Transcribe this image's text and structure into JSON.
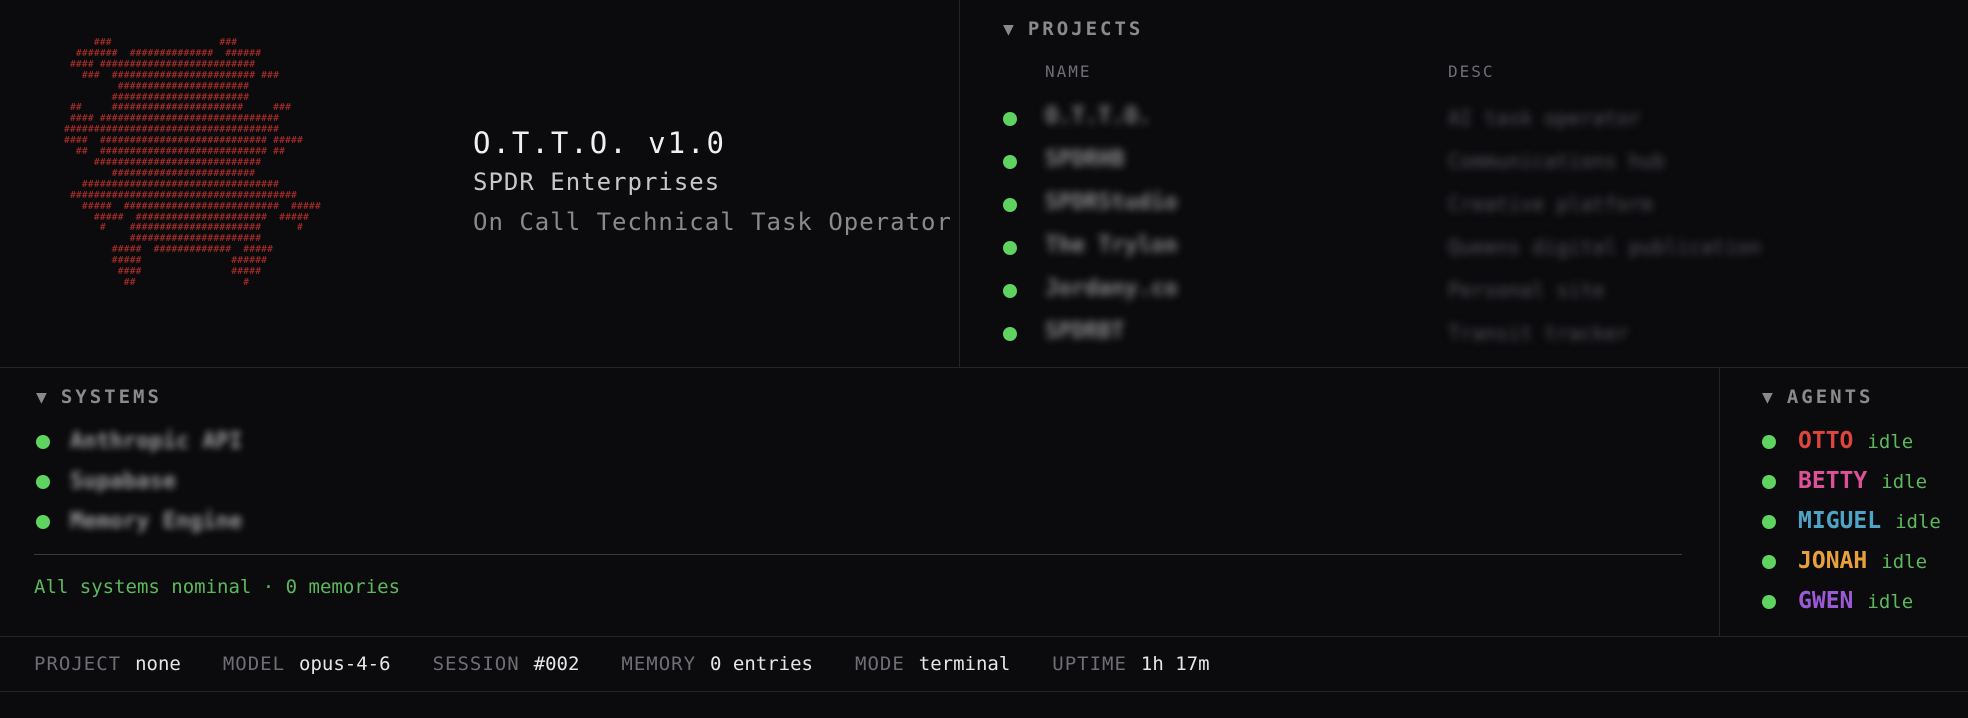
{
  "logo": {
    "ascii_art": "      ###                  ###\n   #######  ##############  ######\n  #### ##########################\n    ###  ######################## ###\n          ######################\n         #######################\n  ##     ######################     ###\n  #### ##############################\n ####################################\n ####  ############################ #####\n   ##  ############################ ##\n      ############################\n         ########################\n    #################################\n  ######################################\n    #####  ##########################  #####\n      #####  ######################  #####\n       #    ######################      #\n            ######################\n         #####  #############  #####\n         #####               ######\n          ####               #####\n           ##                  #"
  },
  "brand": {
    "title": "O.T.T.O. v1.0",
    "company": "SPDR Enterprises",
    "description": "On Call Technical Task Operator"
  },
  "projects": {
    "title": "PROJECTS",
    "col_name": "NAME",
    "col_desc": "DESC",
    "rows": [
      {
        "name": "O.T.T.O.",
        "desc": "AI task operator"
      },
      {
        "name": "SPDRHB",
        "desc": "Communications hub"
      },
      {
        "name": "SPDRStudio",
        "desc": "Creative platform"
      },
      {
        "name": "The Trylon",
        "desc": "Queens digital publication"
      },
      {
        "name": "Jordany.co",
        "desc": "Personal site"
      },
      {
        "name": "SPDRBT",
        "desc": "Transit tracker"
      }
    ]
  },
  "systems": {
    "title": "SYSTEMS",
    "items": [
      {
        "name": "Anthropic API"
      },
      {
        "name": "Supabase"
      },
      {
        "name": "Memory Engine"
      }
    ],
    "status": "All systems nominal · 0 memories"
  },
  "agents": {
    "title": "AGENTS",
    "items": [
      {
        "name": "OTTO",
        "state": "idle",
        "color": "#e0443e"
      },
      {
        "name": "BETTY",
        "state": "idle",
        "color": "#e0509a"
      },
      {
        "name": "MIGUEL",
        "state": "idle",
        "color": "#4fa3c7"
      },
      {
        "name": "JONAH",
        "state": "idle",
        "color": "#e8a13a"
      },
      {
        "name": "GWEN",
        "state": "idle",
        "color": "#9b59d6"
      }
    ]
  },
  "statusbar": {
    "project_label": "PROJECT",
    "project_value": "none",
    "model_label": "MODEL",
    "model_value": "opus-4-6",
    "session_label": "SESSION",
    "session_value": "#002",
    "memory_label": "MEMORY",
    "memory_value": "0 entries",
    "mode_label": "MODE",
    "mode_value": "terminal",
    "uptime_label": "UPTIME",
    "uptime_value": "1h 17m"
  },
  "colors": {
    "background": "#0b0b0e",
    "status_dot": "#5fd35f",
    "logo_red": "#b5302b"
  }
}
